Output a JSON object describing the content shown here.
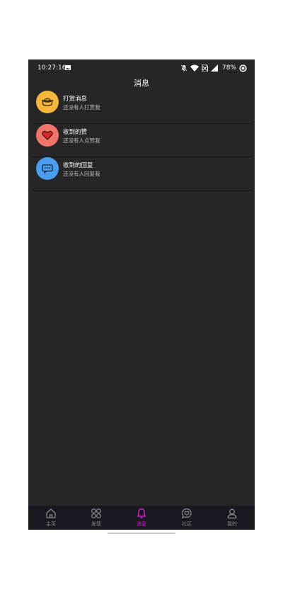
{
  "status_bar": {
    "time": "10:27:16",
    "battery": "78%"
  },
  "header": {
    "title": "消息"
  },
  "messages": [
    {
      "title": "打赏消息",
      "subtitle": "还没有人打赏我",
      "icon": "gift-ingot-icon",
      "color": "#f4b73a"
    },
    {
      "title": "收到的赞",
      "subtitle": "还没有人点赞我",
      "icon": "heart-icon",
      "color": "#f2756a"
    },
    {
      "title": "收到的回复",
      "subtitle": "还没有人回复我",
      "icon": "chat-icon",
      "color": "#4a9ef0"
    }
  ],
  "tabs": [
    {
      "label": "主页",
      "icon": "home-icon"
    },
    {
      "label": "发现",
      "icon": "discover-icon"
    },
    {
      "label": "消息",
      "icon": "bell-icon",
      "active": true
    },
    {
      "label": "社区",
      "icon": "community-icon"
    },
    {
      "label": "我的",
      "icon": "profile-icon"
    }
  ],
  "colors": {
    "background": "#262626",
    "tab_bar": "#181820",
    "accent": "#e020e0"
  }
}
